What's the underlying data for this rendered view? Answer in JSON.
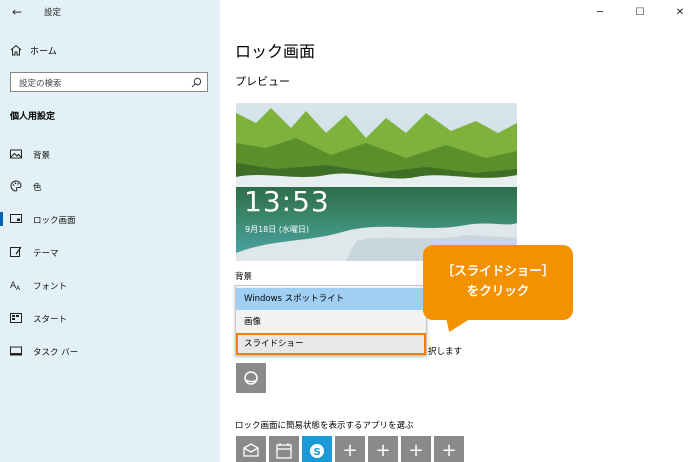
{
  "app": {
    "back_glyph": "←",
    "title": "設定"
  },
  "sidebar": {
    "home_label": "ホーム",
    "search_placeholder": "設定の検索",
    "section_title": "個人用設定",
    "items": [
      {
        "label": "背景",
        "icon": "picture-icon"
      },
      {
        "label": "色",
        "icon": "palette-icon"
      },
      {
        "label": "ロック画面",
        "icon": "lock-screen-icon",
        "active": true
      },
      {
        "label": "テーマ",
        "icon": "brush-icon"
      },
      {
        "label": "フォント",
        "icon": "font-icon"
      },
      {
        "label": "スタート",
        "icon": "start-icon"
      },
      {
        "label": "タスク バー",
        "icon": "taskbar-icon"
      }
    ]
  },
  "window_controls": {
    "minimize": "─",
    "maximize": "☐",
    "close": "✕"
  },
  "main": {
    "page_title": "ロック画面",
    "preview_label": "プレビュー",
    "clock": "13:53",
    "date": "9月18日 (水曜日)",
    "background_label": "背景",
    "dropdown_options": [
      "Windows スポットライト",
      "画像",
      "スライドショー"
    ],
    "dropdown_selected": "Windows スポットライト",
    "dropdown_highlighted": "スライドショー",
    "choose_text_partial": "択します",
    "apps_label": "ロック画面に簡易状態を表示するアプリを選ぶ",
    "plus_glyph": "+"
  },
  "callout": {
    "line1": "［スライドショー］",
    "line2": "をクリック",
    "color": "#f39100"
  },
  "colors": {
    "sidebar_bg": "#e3f1f7",
    "accent": "#0063b1",
    "selected_option": "#9fd0f4",
    "highlight_border": "#f08000"
  }
}
